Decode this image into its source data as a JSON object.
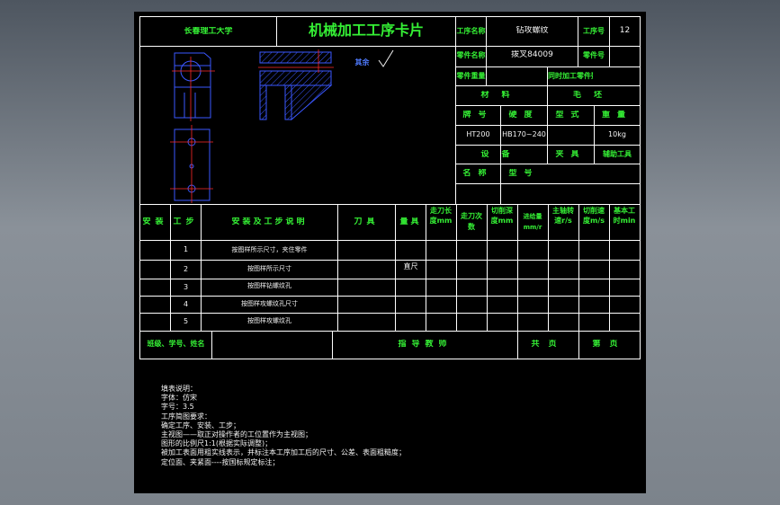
{
  "header": {
    "school": "长春理工大学",
    "title": "机械加工工序卡片",
    "process_name_label": "工序名称",
    "process_name_value": "钻攻螺纹",
    "process_no_label": "工序号",
    "process_no_value": "12",
    "part_name_label": "零件名称",
    "part_name_value": "拨叉84009",
    "part_no_label": "零件号",
    "part_weight_label": "零件重量",
    "same_time_label": "同时加工零件数"
  },
  "drawing": {
    "roughness_label": "其余"
  },
  "material": {
    "section_label": "材料",
    "blank_label": "毛坯",
    "grade_label": "牌号",
    "hardness_label": "硬度",
    "form_label": "型式",
    "weight_label": "重量",
    "grade_value": "HT200",
    "hardness_value": "HB170~240",
    "weight_value": "10kg"
  },
  "equipment": {
    "equipment_label": "设备",
    "fixture_label": "夹具",
    "aux_tool_label": "辅助工具",
    "name_label": "名称",
    "model_label": "型号"
  },
  "table": {
    "headers": {
      "install": "安装",
      "step": "工步",
      "desc": "安装及工步说明",
      "tool": "刀具",
      "gauge": "量具",
      "cut_length": "走刀长度mm",
      "passes": "走刀次数",
      "depth": "切削深度mm",
      "feed": "进给量mm/r",
      "speed": "主轴转速r/s",
      "cut_speed": "切削速度m/s",
      "base_time": "基本工时min"
    },
    "rows": [
      {
        "step": "1",
        "desc": "按图样所示尺寸，夹住零件",
        "gauge": ""
      },
      {
        "step": "2",
        "desc": "按图样所示尺寸",
        "gauge": "直尺"
      },
      {
        "step": "3",
        "desc": "按图样钻螺纹孔",
        "gauge": ""
      },
      {
        "step": "4",
        "desc": "按图样攻螺纹孔尺寸",
        "gauge": ""
      },
      {
        "step": "5",
        "desc": "按图样攻螺纹孔",
        "gauge": ""
      }
    ],
    "footer": {
      "class": "班级、学号、姓名",
      "teacher": "指导教师",
      "page": "共页",
      "sheet": "第页"
    }
  },
  "notes": [
    "填表说明：",
    "字体：仿宋",
    "字号：3.5",
    "工序简图要求：",
    "确定工序、安装、工步；",
    "主视图——取正对操作者的工位置作为主视图；",
    "图形的比例尺1:1(根据实际调整)；",
    "被加工表面用粗实线表示，并标注本工序加工后的尺寸、公差、表面粗糙度；",
    "定位面、夹紧面----按国标规定标注；"
  ],
  "colors": {
    "label_green": "#35f035",
    "value_white": "#f2f2f2",
    "part_blue": "#3a57ff",
    "center_red": "#ff2a2a",
    "sheet_black": "#000000"
  }
}
